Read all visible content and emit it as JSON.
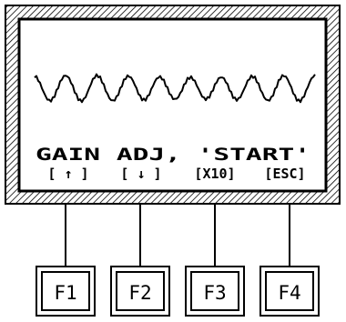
{
  "display": {
    "message_line": "GAIN ADJ, 'START'",
    "softkey_labels": [
      "[ ↑ ]",
      "[ ↓ ]",
      "[X10]",
      "[ESC]"
    ]
  },
  "keys": [
    {
      "label": "F1"
    },
    {
      "label": "F2"
    },
    {
      "label": "F3"
    },
    {
      "label": "F4"
    }
  ],
  "colors": {
    "ink": "#000000",
    "background": "#ffffff"
  }
}
